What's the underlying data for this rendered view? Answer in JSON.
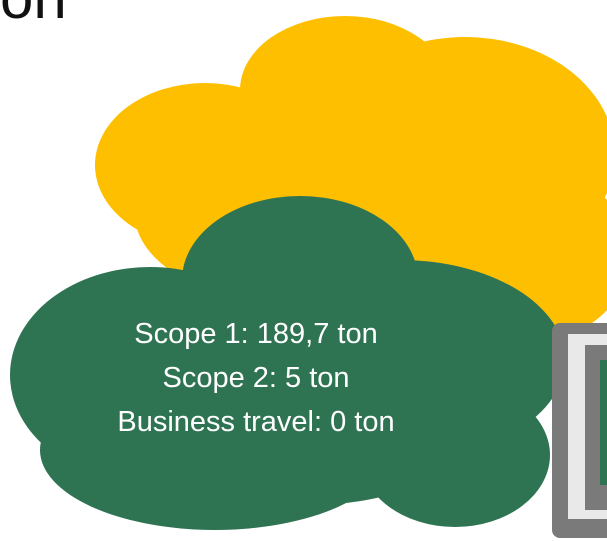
{
  "heading_fragment": "on",
  "green_cloud": {
    "lines": [
      "Scope 1: 189,7 ton",
      "Scope 2: 5 ton",
      "Business travel: 0 ton"
    ]
  },
  "colors": {
    "yellow_cloud": "#FDBF00",
    "green_cloud": "#2F7452",
    "box_outer": "#7A7A7A",
    "box_inner": "#E9E9E9",
    "box_core": "#2F7452"
  }
}
